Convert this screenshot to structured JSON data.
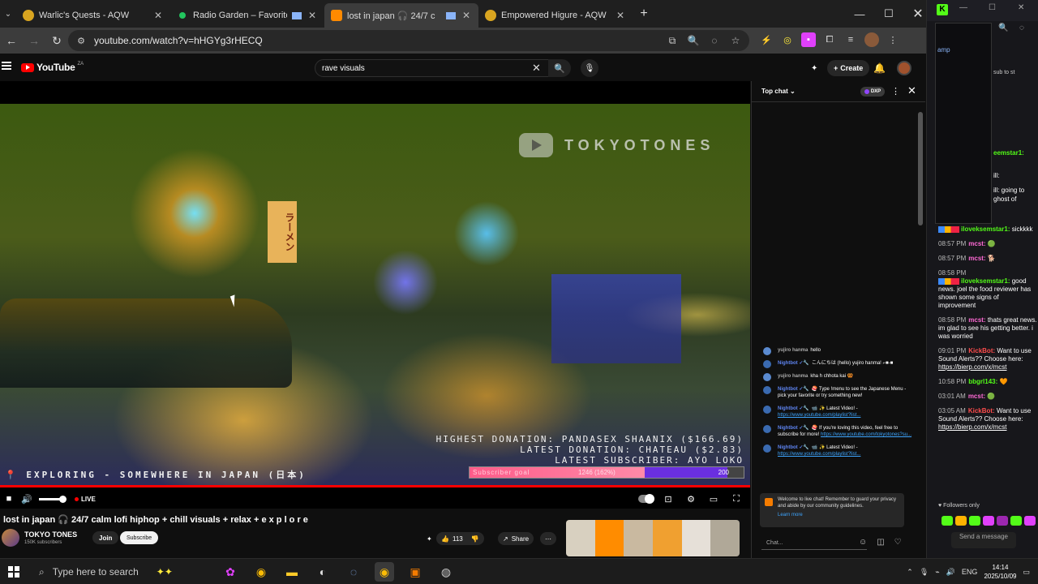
{
  "browser": {
    "tabs": [
      {
        "label": "Warlic's Quests - AQW",
        "active": false,
        "favicon_color": "#d9a520"
      },
      {
        "label": "Radio Garden – Favorites",
        "active": false,
        "favicon_color": "#22c55e"
      },
      {
        "label": "lost in japan 🎧 24/7 c",
        "active": true,
        "favicon_color": "#ff8a00"
      },
      {
        "label": "Empowered Higure - AQW",
        "active": false,
        "favicon_color": "#d9a520"
      }
    ],
    "new_tab_glyph": "+",
    "url": "youtube.com/watch?v=hHGYg3rHECQ"
  },
  "youtube": {
    "logo_text": "YouTube",
    "country_code": "ZA",
    "search_value": "rave visuals",
    "create_label": "Create"
  },
  "video": {
    "watermark": "TOKYOTONES",
    "sign_text": "ラーメン",
    "highest_donation": "HIGHEST DONATION: PANDASEX SHAANIX  ($166.69)",
    "latest_donation": "LATEST DONATION: CHATEAU ($2.83)",
    "latest_subscriber": "LATEST SUBSCRIBER: AYO LOKO",
    "exploring": "📍 EXPLORING - SOMEWHERE IN JAPAN (日本)",
    "sub_goal_label": "Subscriber goal",
    "sub_goal_count": "1246 (162%)",
    "sub_goal_target": "200",
    "sub_goal_fraction": 0.64,
    "live_label": "LIVE",
    "title": "lost in japan 🎧 24/7 calm lofi hiphop + chill visuals + relax + e x p l o r e",
    "channel_name": "TOKYO TONES",
    "subscribers": "150K subscribers",
    "join_label": "Join",
    "subscribe_label": "Subscribe",
    "likes": "113",
    "share_label": "Share"
  },
  "chat": {
    "header": "Top chat",
    "dxp_label": "DXP",
    "messages": [
      {
        "author": "yujiro hanma",
        "bot": false,
        "text": "hello"
      },
      {
        "author": "Nightbot ✓🔧",
        "bot": true,
        "text": "こんにちは (hello) yujiro hanma! ⌐■-■"
      },
      {
        "author": "yujiro hanma",
        "bot": false,
        "text": "kha h chhota kai 🥨"
      },
      {
        "author": "Nightbot ✓🔧",
        "bot": true,
        "text": "🍣 Type !menu to see the Japanese Menu - pick your favorite or try something new!"
      },
      {
        "author": "Nightbot ✓🔧",
        "bot": true,
        "text": "📹 ✨ Latest Video! - ",
        "link": "https://www.youtube.com/playlist?list..."
      },
      {
        "author": "Nightbot ✓🔧",
        "bot": true,
        "text": "🍣 If you're loving this video, feel free to subscribe for more! ",
        "link": "https://www.youtube.com/tokyotones?su..."
      },
      {
        "author": "Nightbot ✓🔧",
        "bot": true,
        "text": "📹 ✨ Latest Video! - ",
        "link": "https://www.youtube.com/playlist?list..."
      }
    ],
    "welcome": "Welcome to live chat! Remember to guard your privacy and abide by our community guidelines.",
    "learn_more": "Learn more",
    "input_placeholder": "Chat..."
  },
  "side_window": {
    "fragments": [
      "amp",
      "sub to",
      "st",
      "eemstar1:",
      "ill:",
      "ill: going to",
      "ghost of"
    ],
    "feed": [
      {
        "time": "",
        "user": "iloveksemstar1:",
        "text": "sickkkk",
        "user_color": "green"
      },
      {
        "time": "08:57 PM",
        "user": "mcst:",
        "text": "🟢",
        "user_color": "green"
      },
      {
        "time": "08:57 PM",
        "user": "mcst:",
        "text": "🐕",
        "user_color": "green"
      },
      {
        "time": "08:58 PM",
        "user": "iloveksemstar1:",
        "text": "good news. joel the food reviewer has shown some signs of improvement",
        "user_color": "green"
      },
      {
        "time": "08:58 PM",
        "user": "mcst:",
        "text": "thats great news. im glad to see his getting better. i was worried",
        "user_color": "green"
      },
      {
        "time": "09:01 PM",
        "user": "KickBot:",
        "text": "Want to use Sound Alerts?? Choose here: ",
        "link": "https://bierp.com/x/mcst",
        "user_color": "green"
      },
      {
        "time": "10:58 PM",
        "user": "bbgrl143:",
        "text": "🧡",
        "user_color": "pink"
      },
      {
        "time": "03:01 AM",
        "user": "mcst:",
        "text": "🟢",
        "user_color": "green"
      },
      {
        "time": "03:05 AM",
        "user": "KickBot:",
        "text": "Want to use Sound Alerts?? Choose here: ",
        "link": "https://bierp.com/x/mcst",
        "user_color": "green"
      }
    ],
    "followers_label": "♥ Followers only",
    "send_label": "Send a message"
  },
  "taskbar": {
    "search_placeholder": "Type here to search",
    "language": "ENG",
    "time": "14:14",
    "date": "2025/10/09"
  },
  "colors": {
    "accent_red": "#ff0000",
    "kick_green": "#53fc18",
    "link_blue": "#3ea6ff"
  }
}
